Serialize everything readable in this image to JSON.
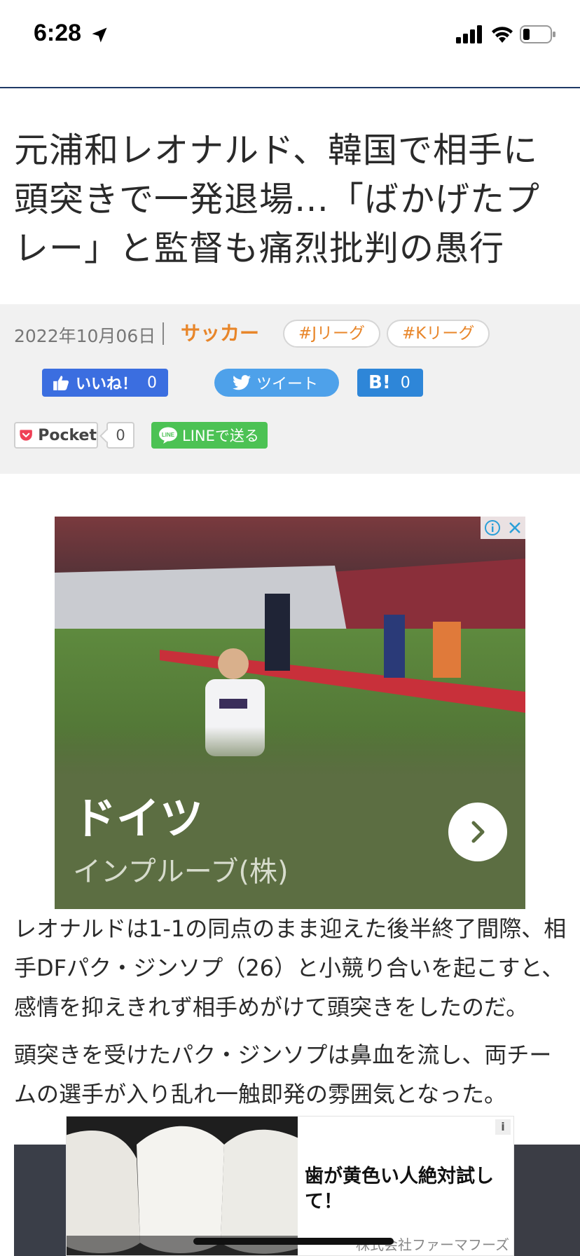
{
  "status_bar": {
    "time": "6:28",
    "icons": [
      "location-arrow-icon",
      "cellular-signal-icon",
      "wifi-icon",
      "battery-icon"
    ]
  },
  "article": {
    "title": "元浦和レオナルド、韓国で相手に頭突きで一発退場…「ばかげたプレー」と監督も痛烈批判の愚行",
    "date": "2022年10月06日",
    "category": "サッカー",
    "tags": [
      "#Jリーグ",
      "#Kリーグ"
    ]
  },
  "share": {
    "facebook": {
      "label": "いいね！",
      "count": "0"
    },
    "twitter": {
      "label": "ツイート"
    },
    "hatena": {
      "label": "B!",
      "count": "0"
    },
    "pocket": {
      "label": "Pocket",
      "count": "0"
    },
    "line": {
      "label": "LINEで送る"
    }
  },
  "ad_top": {
    "title": "ドイツ",
    "advertiser": "インプルーブ(株)",
    "bg_color": "#5c6e42"
  },
  "body": {
    "paragraphs": [
      "レオナルドは1-1の同点のまま迎えた後半終了間際、相手DFパク・ジンソプ（26）と小競り合いを起こすと、感情を抑えきれず相手めがけて頭突きをしたのだ。",
      "頭突きを受けたパク・ジンソプは鼻血を流し、両チームの選手が入り乱れ一触即発の雰囲気となった。"
    ]
  },
  "ad_bottom": {
    "title": "歯が黄色い人絶対試して！",
    "advertiser": "株式会社ファーマフーズ",
    "info": "i"
  },
  "colors": {
    "accent": "#e8862a",
    "header_rule": "#1f3a66",
    "facebook": "#3b6ee0",
    "twitter": "#4ea1ea",
    "hatena": "#2e86d8",
    "line": "#4cc254"
  }
}
